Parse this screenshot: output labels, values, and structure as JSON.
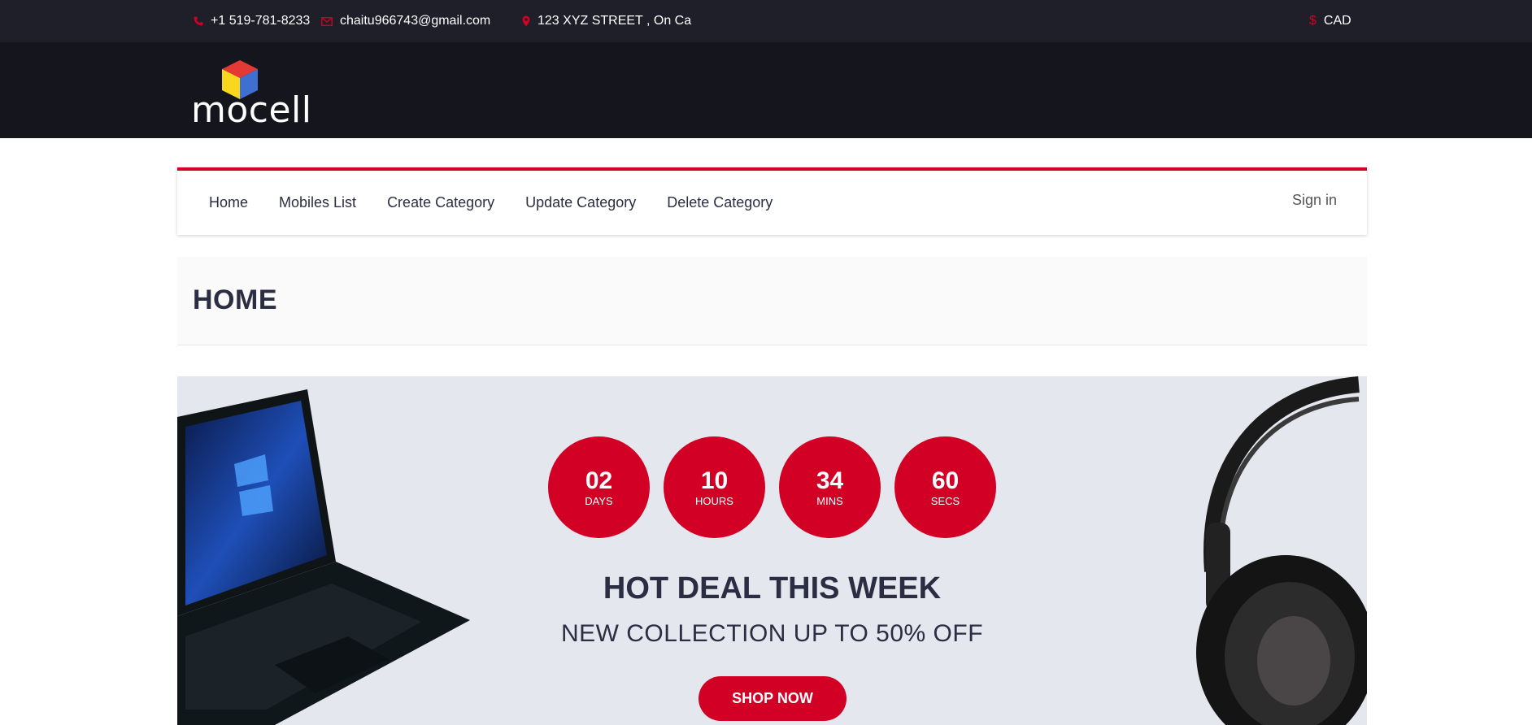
{
  "topbar": {
    "phone": "+1 519-781-8233",
    "email": "chaitu966743@gmail.com",
    "address": "123 XYZ STREET , On Ca",
    "currency": "CAD",
    "phone_icon": "phone-icon",
    "email_icon": "envelope-icon",
    "address_icon": "map-marker-icon",
    "currency_icon": "dollar-icon"
  },
  "header": {
    "logo_text": "mocell"
  },
  "nav": {
    "items": [
      {
        "label": "Home"
      },
      {
        "label": "Mobiles List"
      },
      {
        "label": "Create Category"
      },
      {
        "label": "Update Category"
      },
      {
        "label": "Delete Category"
      }
    ],
    "signin": "Sign in"
  },
  "breadcrumb": {
    "title": "HOME"
  },
  "hot_deal": {
    "timer": [
      {
        "value": "02",
        "label": "DAYS"
      },
      {
        "value": "10",
        "label": "HOURS"
      },
      {
        "value": "34",
        "label": "MINS"
      },
      {
        "value": "60",
        "label": "SECS"
      }
    ],
    "title": "HOT DEAL THIS WEEK",
    "subtitle": "NEW COLLECTION UP TO 50% OFF",
    "button": "SHOP NOW"
  },
  "colors": {
    "accent": "#d10024",
    "topbar_bg": "#1e1f29",
    "header_bg": "#15161d",
    "deal_bg": "#e4e7ed"
  }
}
